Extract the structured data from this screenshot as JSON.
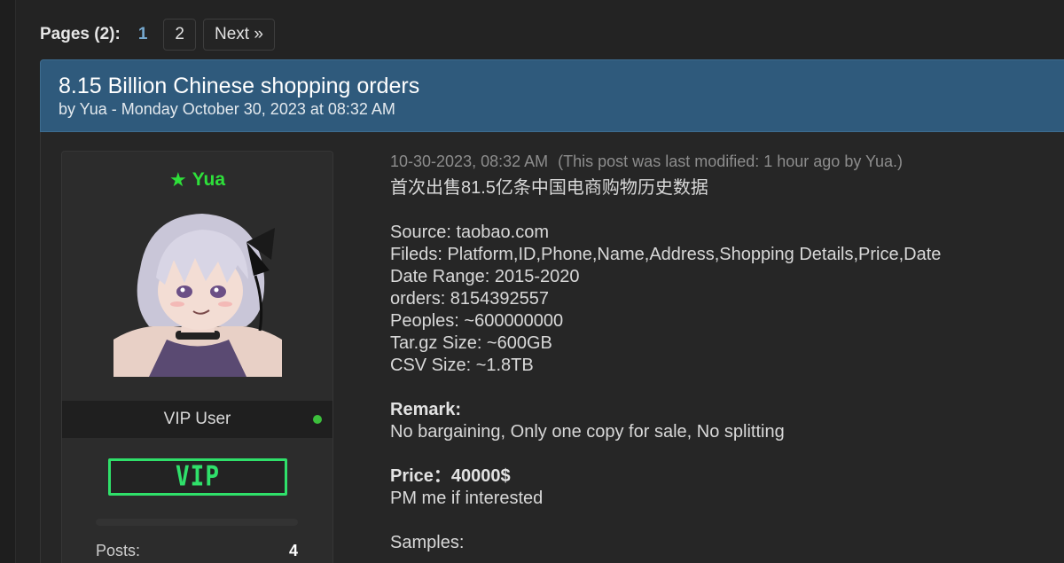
{
  "pagination": {
    "label": "Pages (2):",
    "current": "1",
    "pages": [
      "2"
    ],
    "next": "Next »"
  },
  "thread": {
    "title": "8.15 Billion Chinese shopping orders",
    "byline": "by Yua - Monday October 30, 2023 at 08:32 AM"
  },
  "user": {
    "name": "Yua",
    "group": "VIP User",
    "badge": "VIP",
    "stats": [
      {
        "label": "Posts:",
        "value": "4"
      }
    ],
    "colors": {
      "username": "#2ee03a",
      "badge": "#2fe06a",
      "online": "#3cbf3c"
    }
  },
  "post": {
    "date": "10-30-2023, 08:32 AM",
    "modified": "(This post was last modified: 1 hour ago by Yua.)",
    "headline_cn": "首次出售81.5亿条中国电商购物历史数据",
    "details": [
      "Source: taobao.com",
      "Fileds: Platform,ID,Phone,Name,Address,Shopping Details,Price,Date",
      "Date Range: 2015-2020",
      "orders: 8154392557",
      "Peoples: ~600000000",
      "Tar.gz Size: ~600GB",
      "CSV Size: ~1.8TB"
    ],
    "remark_label": "Remark:",
    "remark_text": "No bargaining, Only one copy for sale, No splitting",
    "price_label": "Price：40000$",
    "price_note": "PM me if interested",
    "samples_label": "Samples:"
  },
  "colors": {
    "header_bg": "#2f5a7c",
    "page_bg": "#232323",
    "current_page": "#76a9cf"
  }
}
